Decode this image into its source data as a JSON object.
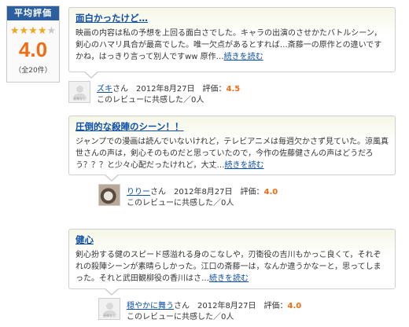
{
  "summary": {
    "heading": "平均評価",
    "stars_filled": 4,
    "stars_total": 5,
    "average": "4.0",
    "total": "（全20件）"
  },
  "reviews": [
    {
      "title": "面白かったけど…",
      "body": "映画の内容は私の予想を上回る面白さでした。キャラの出演のさせかたバトルシーン，剣心のハマリ具合が最高でした。唯一欠点があるとすれば…斎藤一の原作との違いですかね，はっきり言って別人ですww 原作…",
      "more": "続きを読む",
      "user": "ズキ",
      "honorific": "さん",
      "date": "2012年8月27日",
      "rating_label": "評価：",
      "rating": "4.5",
      "empathy": "このレビューに共感した／0人",
      "avatar_caption": "画像なし"
    },
    {
      "title": "圧倒的な殺陣のシーン！！",
      "body": "ジャンプでの漫画は読んでいないけれど，テレビアニメは毎週欠かさず見ていた。涼風真世さんの声は，剣心そのものだと思っていたので，今作の佐藤健さんの声はどうだろう？？？と少々心配だったけれど，大丈…",
      "more": "続きを読む",
      "user": "りりー",
      "honorific": "さん",
      "date": "2012年8月27日",
      "rating_label": "評価：",
      "rating": "4.0",
      "empathy": "このレビューに共感した／0人",
      "avatar_caption": ""
    },
    {
      "title": "健心",
      "body": "剣心扮する健のスピード感溢れる身のこなしや，刃衛役の吉川もかっこ良くて，それぞれの殺陣シーンが素晴らしかった。江口の斎藤一は，なんか違うかなーと，思ってしまった。それと武田観柳役の香川はさ…",
      "more": "続きを読む",
      "user": "穏やかに舞う",
      "honorific": "さん",
      "date": "2012年8月27日",
      "rating_label": "評価：",
      "rating": "4.0",
      "empathy": "このレビューに共感した／0人",
      "avatar_caption": "画像なし"
    }
  ],
  "colors": {
    "heading_bg": "#2b5f9f",
    "link": "#0d4fa8",
    "score": "#f36b12",
    "star": "#f3a51c"
  }
}
